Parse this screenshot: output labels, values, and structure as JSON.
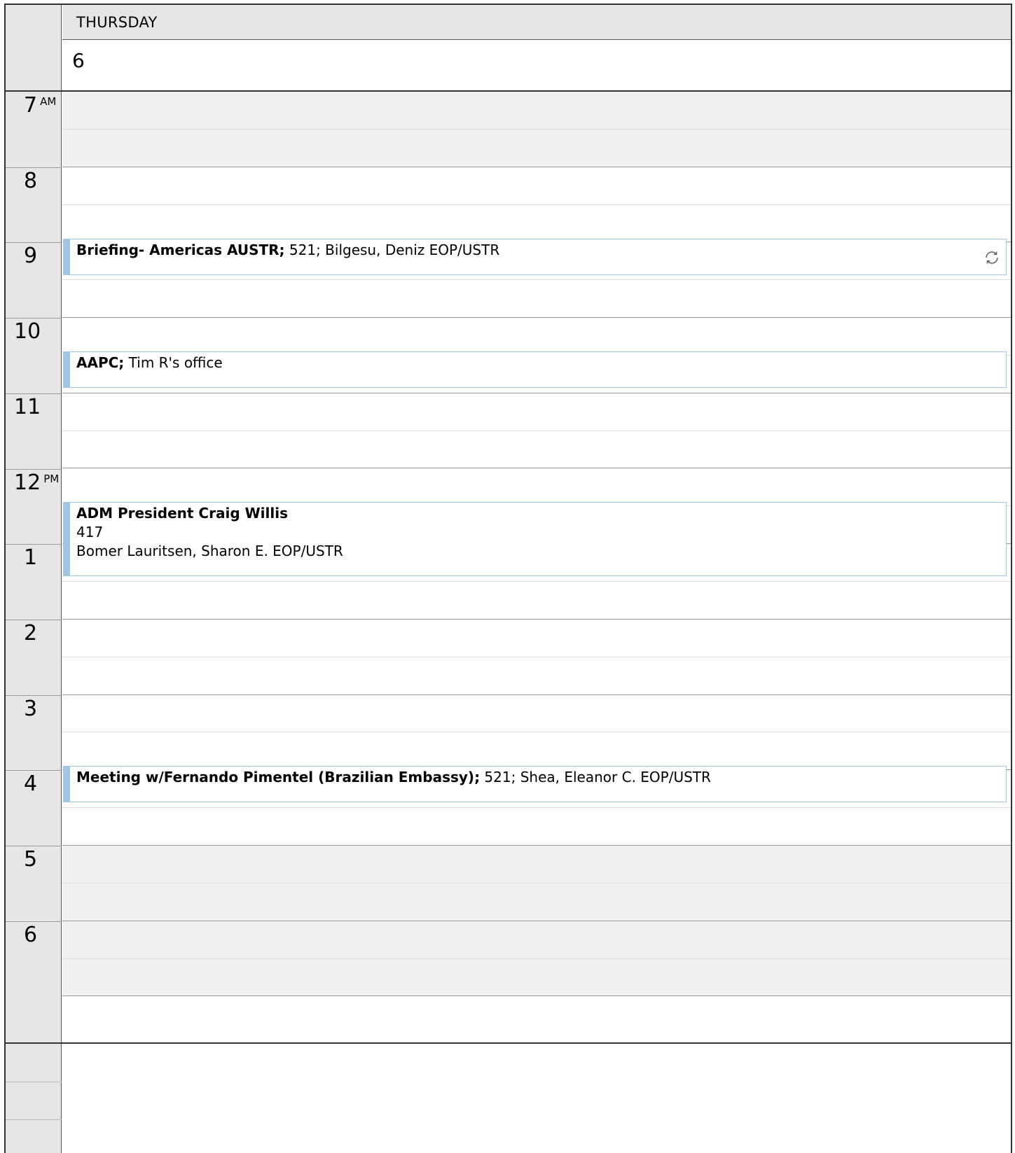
{
  "header": {
    "day_name": "THURSDAY",
    "date": "6"
  },
  "hours": [
    {
      "label": "7",
      "suffix": "AM"
    },
    {
      "label": "8",
      "suffix": ""
    },
    {
      "label": "9",
      "suffix": ""
    },
    {
      "label": "10",
      "suffix": ""
    },
    {
      "label": "11",
      "suffix": ""
    },
    {
      "label": "12",
      "suffix": "PM"
    },
    {
      "label": "1",
      "suffix": ""
    },
    {
      "label": "2",
      "suffix": ""
    },
    {
      "label": "3",
      "suffix": ""
    },
    {
      "label": "4",
      "suffix": ""
    },
    {
      "label": "5",
      "suffix": ""
    },
    {
      "label": "6",
      "suffix": ""
    }
  ],
  "events": [
    {
      "title": "Briefing- Americas AUSTR;",
      "details": " 521; Bilgesu, Deniz EOP/USTR",
      "recurring_icon": "recurring-icon"
    },
    {
      "title": "AAPC;",
      "details": " Tim R's office"
    },
    {
      "title": "ADM President Craig Willis",
      "location": "417",
      "organizer": "Bomer Lauritsen, Sharon E. EOP/USTR"
    },
    {
      "title": "Meeting w/Fernando Pimentel (Brazilian Embassy);",
      "details": " 521; Shea, Eleanor C. EOP/USTR"
    }
  ]
}
